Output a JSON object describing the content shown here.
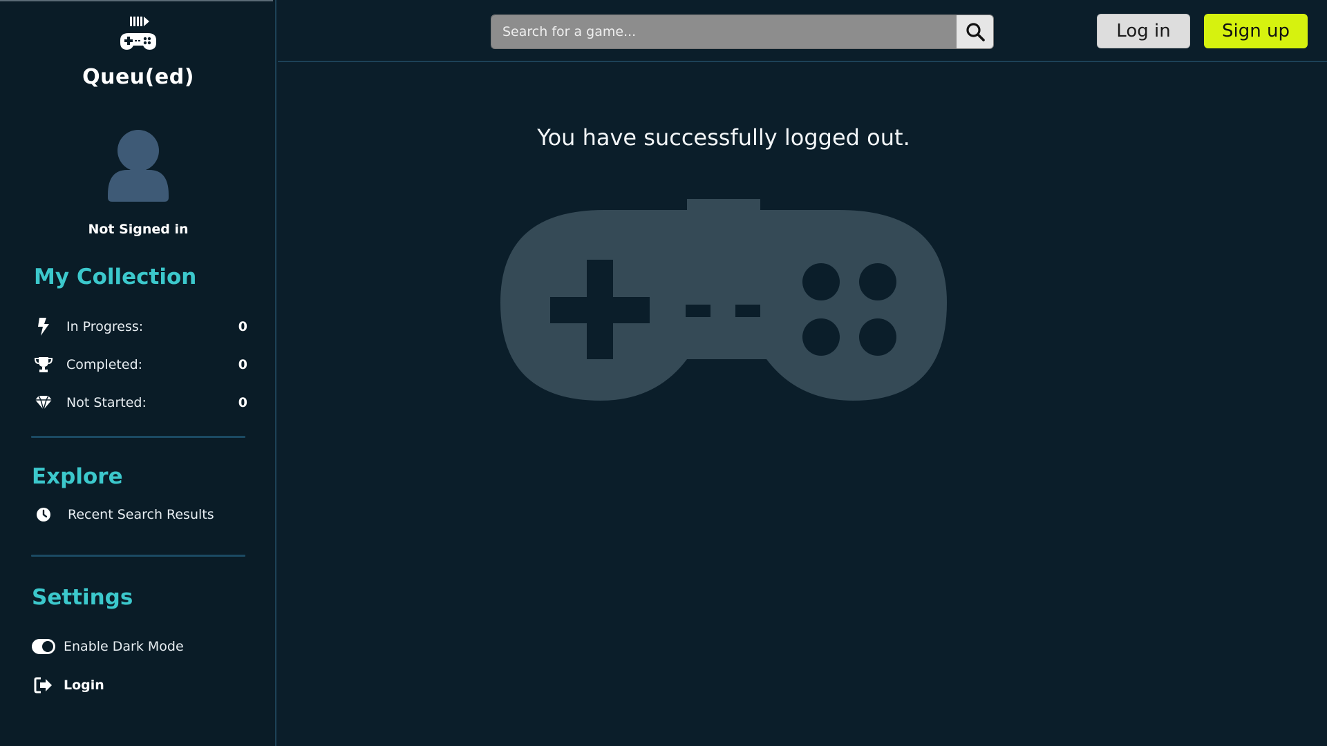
{
  "app": {
    "title": "Queu(ed)"
  },
  "user": {
    "status": "Not Signed in"
  },
  "collection": {
    "heading": "My Collection",
    "items": [
      {
        "label": "In Progress:",
        "count": "0",
        "icon": "bolt-icon"
      },
      {
        "label": "Completed:",
        "count": "0",
        "icon": "trophy-icon"
      },
      {
        "label": "Not Started:",
        "count": "0",
        "icon": "gem-icon"
      }
    ]
  },
  "explore": {
    "heading": "Explore",
    "items": [
      {
        "label": "Recent Search Results",
        "icon": "clock-icon"
      }
    ]
  },
  "settings": {
    "heading": "Settings",
    "dark_mode_label": "Enable Dark Mode",
    "dark_mode_enabled": true,
    "login_label": "Login"
  },
  "header": {
    "search_placeholder": "Search for a game...",
    "login_button": "Log in",
    "signup_button": "Sign up"
  },
  "main": {
    "message": "You have successfully logged out."
  },
  "colors": {
    "background": "#0b1e2a",
    "accent": "#3cc8cc",
    "signup": "#d6f20f",
    "controller": "#354a56"
  }
}
